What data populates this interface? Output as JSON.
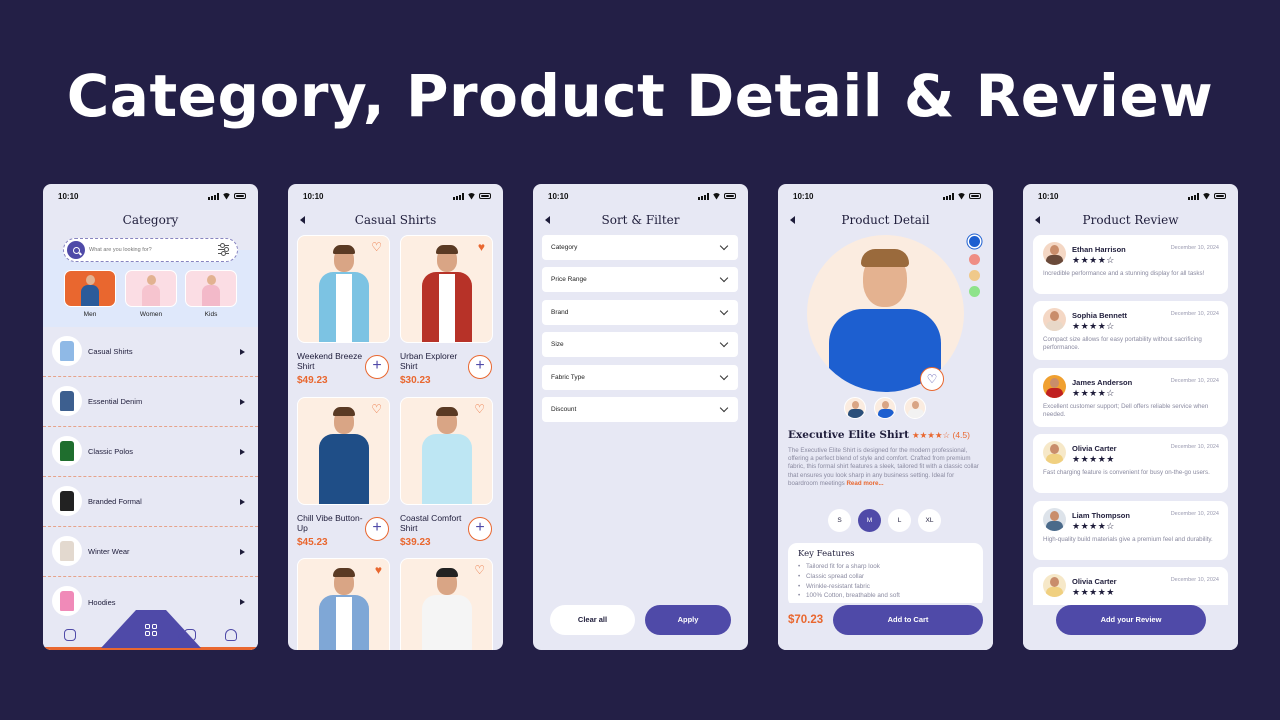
{
  "headline": "Category, Product Detail & Review",
  "status_time": "10:10",
  "category_screen": {
    "title": "Category",
    "search_placeholder": "What are you looking for?",
    "top_categories": [
      {
        "label": "Men",
        "color": "#e9672f"
      },
      {
        "label": "Women",
        "color": "#fbdde4"
      },
      {
        "label": "Kids",
        "color": "#fbdde4"
      }
    ],
    "list": [
      "Casual Shirts",
      "Essential Denim",
      "Classic Polos",
      "Branded Formal",
      "Winter Wear",
      "Hoodies"
    ]
  },
  "casual_screen": {
    "title": "Casual Shirts",
    "products": [
      {
        "name": "Weekend Breeze Shirt",
        "price": "$49.23",
        "liked": false
      },
      {
        "name": "Urban Explorer Shirt",
        "price": "$30.23",
        "liked": true
      },
      {
        "name": "Chill Vibe Button-Up",
        "price": "$45.23",
        "liked": false
      },
      {
        "name": "Coastal Comfort Shirt",
        "price": "$39.23",
        "liked": false
      },
      {
        "name": "",
        "price": "",
        "liked": true
      },
      {
        "name": "",
        "price": "",
        "liked": false
      }
    ]
  },
  "filter_screen": {
    "title": "Sort & Filter",
    "dropdowns": [
      "Category",
      "Price Range",
      "Brand",
      "Size",
      "Fabric Type",
      "Discount"
    ],
    "clear_label": "Clear all",
    "apply_label": "Apply"
  },
  "detail_screen": {
    "title": "Product Detail",
    "colors": [
      "#1d5fd0",
      "#ef8d84",
      "#f0c98a",
      "#8ee38a"
    ],
    "name": "Executive Elite Shirt",
    "rating_stars": "★★★★☆",
    "rating_value": "(4.5)",
    "description": "The Executive Elite Shirt is designed for the modern professional, offering a perfect blend of style and comfort. Crafted from premium fabric, this formal shirt features a sleek, tailored fit with a classic collar that ensures you look sharp in any business setting. Ideal for boardroom meetings ",
    "read_more": "Read more...",
    "sizes": [
      "S",
      "M",
      "L",
      "XL"
    ],
    "selected_size": "M",
    "features_title": "Key Features",
    "features": [
      "Tailored fit for a sharp look",
      "Classic spread collar",
      "Wrinkle-resistant fabric",
      "100% Cotton, breathable and soft"
    ],
    "price": "$70.23",
    "cart_label": "Add to Cart"
  },
  "review_screen": {
    "title": "Product Review",
    "reviews": [
      {
        "name": "Ethan Harrison",
        "date": "December 10, 2024",
        "stars": "★★★★☆",
        "text": "Incredible performance and a stunning display for all tasks!"
      },
      {
        "name": "Sophia Bennett",
        "date": "December 10, 2024",
        "stars": "★★★★☆",
        "text": "Compact size allows for easy portability without sacrificing performance."
      },
      {
        "name": "James Anderson",
        "date": "December 10, 2024",
        "stars": "★★★★☆",
        "text": "Excellent customer support; Dell offers reliable service when needed."
      },
      {
        "name": "Olivia Carter",
        "date": "December 10, 2024",
        "stars": "★★★★★",
        "text": "Fast charging feature is convenient for busy on-the-go users."
      },
      {
        "name": "Liam Thompson",
        "date": "December 10, 2024",
        "stars": "★★★★☆",
        "text": "High-quality build materials give a premium feel and durability."
      },
      {
        "name": "Olivia Carter",
        "date": "December 10, 2024",
        "stars": "★★★★★",
        "text": ""
      }
    ],
    "review_label": "Add your Review"
  }
}
